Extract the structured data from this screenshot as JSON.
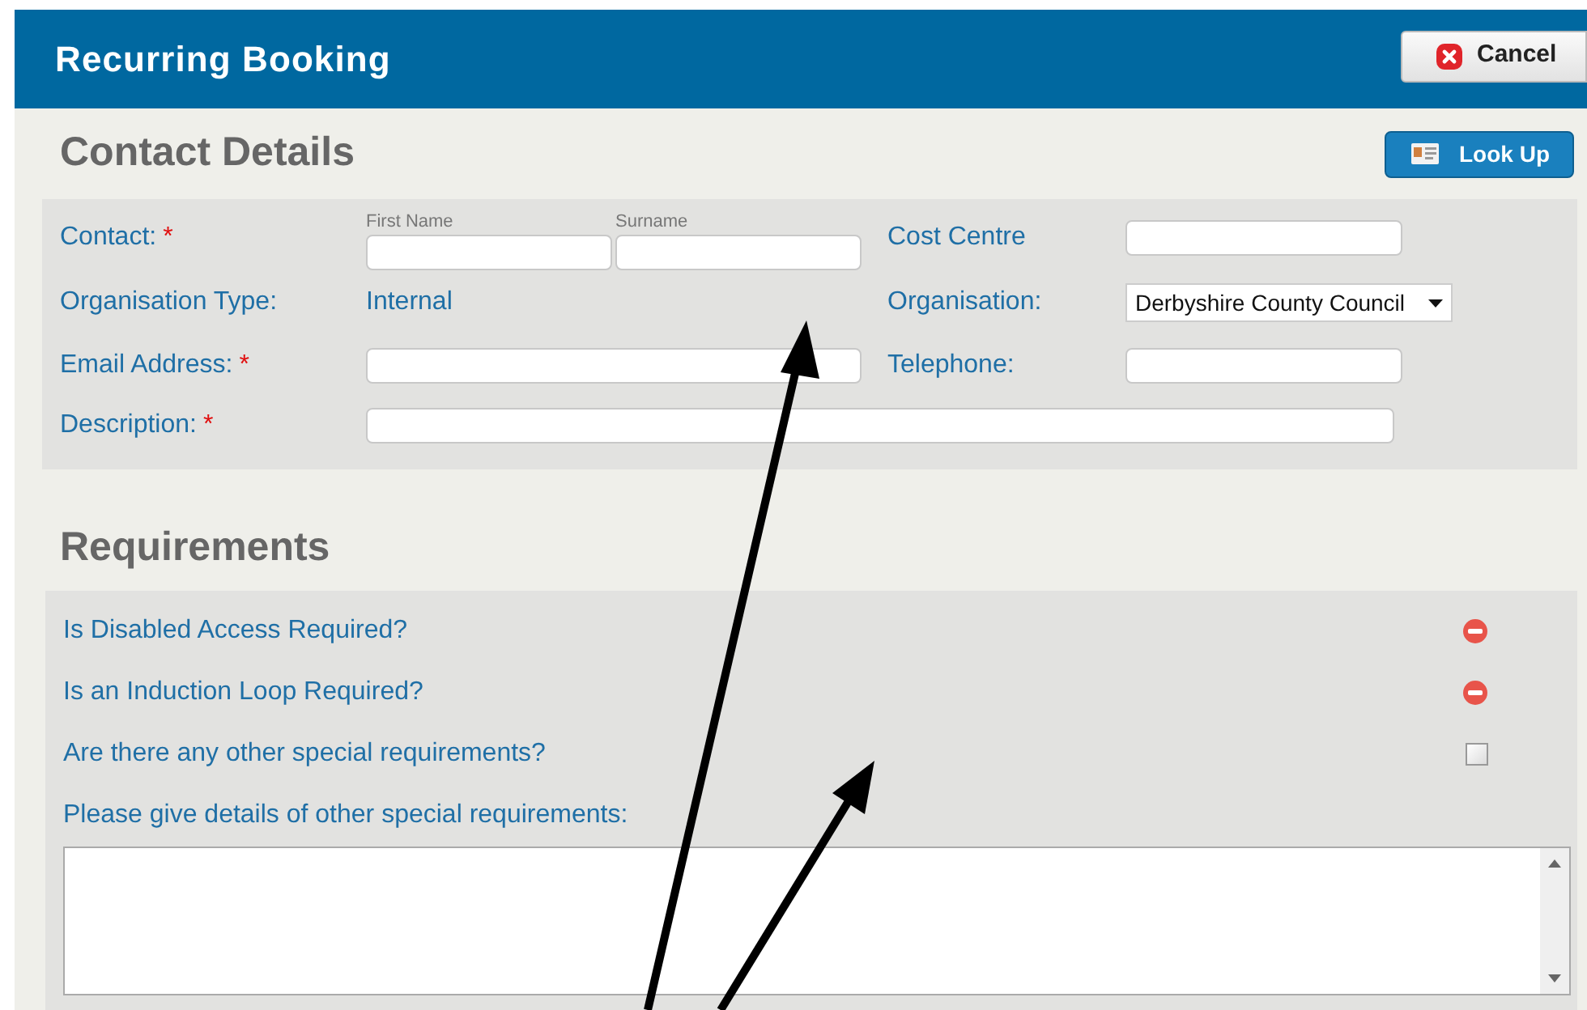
{
  "window": {
    "title": "Recurring Booking",
    "cancel_button": "Cancel"
  },
  "contact_details": {
    "heading": "Contact Details",
    "look_up_button": "Look Up",
    "contact": {
      "label": "Contact:",
      "required_mark": "*",
      "first_name_label": "First Name",
      "surname_label": "Surname"
    },
    "cost_centre": {
      "label": "Cost Centre"
    },
    "organisation_type": {
      "label": "Organisation Type:",
      "value": "Internal"
    },
    "organisation": {
      "label": "Organisation:",
      "value": "Derbyshire County Council"
    },
    "email": {
      "label": "Email Address:",
      "required_mark": "*"
    },
    "telephone": {
      "label": "Telephone:"
    },
    "description": {
      "label": "Description:",
      "required_mark": "*"
    }
  },
  "requirements": {
    "heading": "Requirements",
    "items": [
      {
        "label": "Is Disabled Access Required?",
        "kind": "status"
      },
      {
        "label": "Is an Induction Loop Required?",
        "kind": "status"
      },
      {
        "label": "Are there any other special requirements?",
        "kind": "checkbox",
        "checked": false
      }
    ],
    "details_label": "Please give details of other special requirements:"
  }
}
